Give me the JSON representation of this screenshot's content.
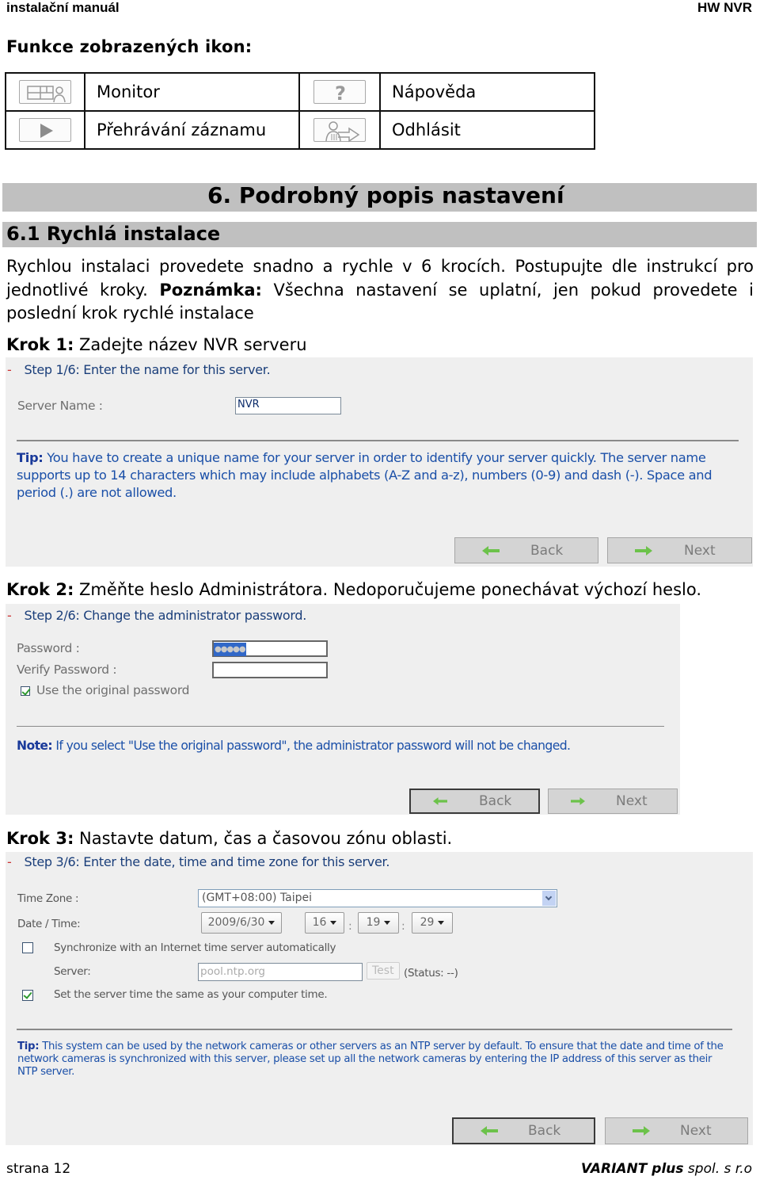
{
  "header": {
    "left": "instalační manuál",
    "right": "HW NVR"
  },
  "icons_section": {
    "title": "Funkce zobrazených ikon:",
    "rows": [
      [
        {
          "icon": "monitor-icon",
          "label": "Monitor"
        },
        {
          "icon": "help-icon",
          "label": "Nápověda"
        }
      ],
      [
        {
          "icon": "play-icon",
          "label": "Přehrávání záznamu"
        },
        {
          "icon": "logout-icon",
          "label": "Odhlásit"
        }
      ]
    ]
  },
  "chapter": {
    "title": "6. Podrobný popis nastavení"
  },
  "section": {
    "title": "6.1  Rychlá instalace",
    "para_1": "Rychlou instalaci provedete snadno a rychle v 6 krocích. Postupujte dle instrukcí pro jednotlivé kroky. ",
    "para_bold": "Poznámka:",
    "para_2": " Všechna nastavení se uplatní, jen pokud provedete i poslední krok rychlé instalace"
  },
  "steps": [
    {
      "heading_bold": "Krok 1:",
      "heading_text": " Zadejte název NVR serveru",
      "panel": {
        "title": "Step 1/6: Enter the name for this server.",
        "server_name_label": "Server Name :",
        "server_name_value": "NVR",
        "tip_label": "Tip:",
        "tip_text": " You have to create a unique name for your server in order to identify your server quickly. The server name supports up to 14 characters which may include alphabets (A-Z and a-z), numbers (0-9) and dash (-). Space and period (.) are not allowed.",
        "back_label": "Back",
        "next_label": "Next"
      }
    },
    {
      "heading_bold": "Krok 2:",
      "heading_text": " Změňte heslo Administrátora. Nedoporučujeme ponechávat výchozí heslo.",
      "panel": {
        "title": "Step 2/6: Change the administrator password.",
        "password_label": "Password :",
        "password_value": "●●●●●",
        "verify_label": "Verify Password :",
        "verify_value": "",
        "use_original_label": "Use the original password",
        "use_original_checked": true,
        "note_label": "Note:",
        "note_text": " If you select \"Use the original password\", the administrator password will not be changed.",
        "back_label": "Back",
        "next_label": "Next"
      }
    },
    {
      "heading_bold": "Krok 3:",
      "heading_text": " Nastavte datum, čas a časovou zónu oblasti.",
      "panel": {
        "title": "Step 3/6: Enter the date, time and time zone for this server.",
        "timezone_label": "Time Zone :",
        "timezone_value": "(GMT+08:00) Taipei",
        "datetime_label": "Date / Time:",
        "date_value": "2009/6/30",
        "hour_value": "16",
        "minute_value": "19",
        "second_value": "29",
        "time_separator": ":",
        "sync_label": "Synchronize with an Internet time server automatically",
        "sync_checked": false,
        "server_label": "Server:",
        "server_value": "pool.ntp.org",
        "test_label": "Test",
        "status_text": "(Status: --)",
        "same_time_label": "Set the server time the same as your computer time.",
        "same_time_checked": true,
        "tip_label": "Tip:",
        "tip_text": " This system can be used by the network cameras or other servers as an NTP server by default. To ensure that the date and time of the network cameras is synchronized with this server, please set up all the network cameras by entering the IP address of this server as their NTP server.",
        "back_label": "Back",
        "next_label": "Next"
      }
    }
  ],
  "footer": {
    "page": "strana 12",
    "company_bold": "VARIANT plus",
    "company_rest": " spol. s r.o"
  },
  "colors": {
    "heading_bar": "#c0c0c0",
    "panel_bg": "#efefef",
    "tip_text": "#1a4fa8",
    "arrow_green": "#6cc24a"
  }
}
